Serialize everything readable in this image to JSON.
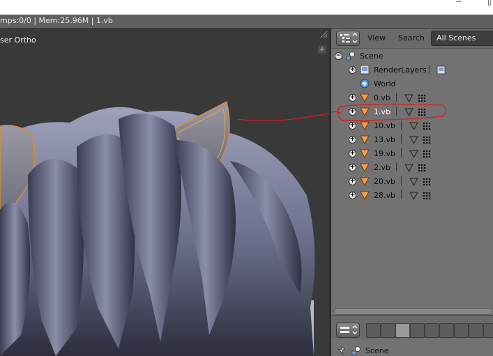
{
  "infobar": {
    "text": "mps:0/0 | Mem:25.96M | 1.vb"
  },
  "viewport": {
    "label": "ser Ortho"
  },
  "outliner": {
    "header": {
      "view": "View",
      "search": "Search",
      "scene_filter": "All Scenes"
    },
    "items": [
      {
        "name": "Scene",
        "kind": "scene"
      },
      {
        "name": "RenderLayers",
        "kind": "renderlayers"
      },
      {
        "name": "World",
        "kind": "world"
      },
      {
        "name": "0.vb",
        "kind": "object"
      },
      {
        "name": "1.vb",
        "kind": "object",
        "selected": true
      },
      {
        "name": "10.vb",
        "kind": "object"
      },
      {
        "name": "13.vb",
        "kind": "object"
      },
      {
        "name": "19.vb",
        "kind": "object"
      },
      {
        "name": "2.vb",
        "kind": "object"
      },
      {
        "name": "20.vb",
        "kind": "object"
      },
      {
        "name": "28.vb",
        "kind": "object"
      }
    ]
  },
  "properties": {
    "context": "Scene"
  },
  "colors": {
    "object_icon": "#e88b2a",
    "annotation": "#d81c1c",
    "hair": "#7a7e98"
  }
}
